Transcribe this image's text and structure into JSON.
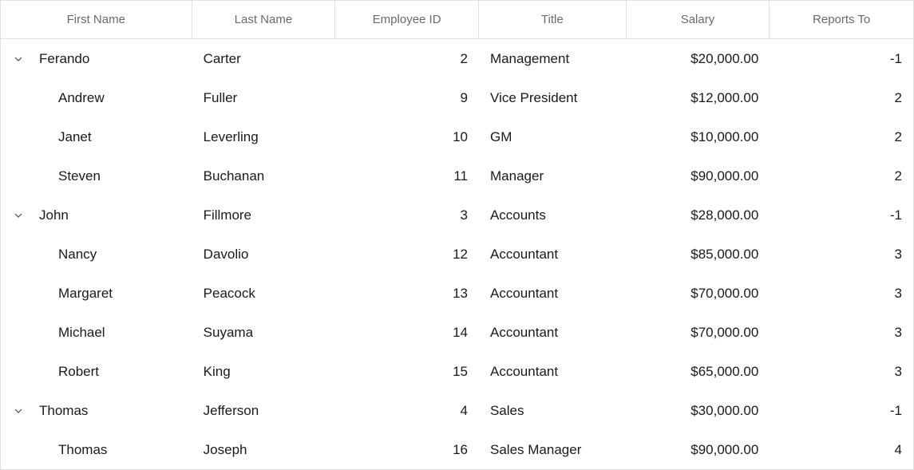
{
  "columns": [
    {
      "key": "first_name",
      "label": "First Name"
    },
    {
      "key": "last_name",
      "label": "Last Name"
    },
    {
      "key": "employee_id",
      "label": "Employee ID"
    },
    {
      "key": "title",
      "label": "Title"
    },
    {
      "key": "salary",
      "label": "Salary"
    },
    {
      "key": "reports_to",
      "label": "Reports To"
    }
  ],
  "rows": [
    {
      "level": 0,
      "expanded": true,
      "first_name": "Ferando",
      "last_name": "Carter",
      "employee_id": "2",
      "title": "Management",
      "salary": "$20,000.00",
      "reports_to": "-1"
    },
    {
      "level": 1,
      "first_name": "Andrew",
      "last_name": "Fuller",
      "employee_id": "9",
      "title": "Vice President",
      "salary": "$12,000.00",
      "reports_to": "2"
    },
    {
      "level": 1,
      "first_name": "Janet",
      "last_name": "Leverling",
      "employee_id": "10",
      "title": "GM",
      "salary": "$10,000.00",
      "reports_to": "2"
    },
    {
      "level": 1,
      "first_name": "Steven",
      "last_name": "Buchanan",
      "employee_id": "11",
      "title": "Manager",
      "salary": "$90,000.00",
      "reports_to": "2"
    },
    {
      "level": 0,
      "expanded": true,
      "first_name": "John",
      "last_name": "Fillmore",
      "employee_id": "3",
      "title": "Accounts",
      "salary": "$28,000.00",
      "reports_to": "-1"
    },
    {
      "level": 1,
      "first_name": "Nancy",
      "last_name": "Davolio",
      "employee_id": "12",
      "title": "Accountant",
      "salary": "$85,000.00",
      "reports_to": "3"
    },
    {
      "level": 1,
      "first_name": "Margaret",
      "last_name": "Peacock",
      "employee_id": "13",
      "title": "Accountant",
      "salary": "$70,000.00",
      "reports_to": "3"
    },
    {
      "level": 1,
      "first_name": "Michael",
      "last_name": "Suyama",
      "employee_id": "14",
      "title": "Accountant",
      "salary": "$70,000.00",
      "reports_to": "3"
    },
    {
      "level": 1,
      "first_name": "Robert",
      "last_name": "King",
      "employee_id": "15",
      "title": "Accountant",
      "salary": "$65,000.00",
      "reports_to": "3"
    },
    {
      "level": 0,
      "expanded": true,
      "first_name": "Thomas",
      "last_name": "Jefferson",
      "employee_id": "4",
      "title": "Sales",
      "salary": "$30,000.00",
      "reports_to": "-1"
    },
    {
      "level": 1,
      "first_name": "Thomas",
      "last_name": "Joseph",
      "employee_id": "16",
      "title": "Sales Manager",
      "salary": "$90,000.00",
      "reports_to": "4"
    }
  ]
}
